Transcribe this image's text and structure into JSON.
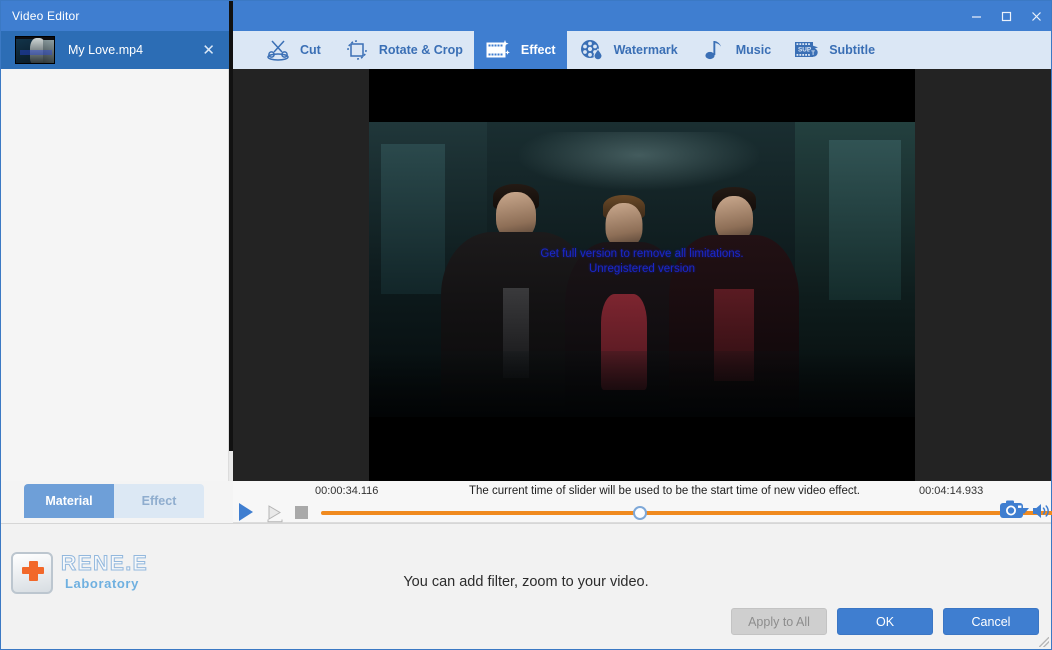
{
  "window": {
    "title": "Video Editor",
    "minimize_label": "—",
    "maximize_label": "☐",
    "close_label": "✕",
    "accent_color": "#3f7ed0"
  },
  "file_tab": {
    "name": "My Love.mp4",
    "close_label": "✕",
    "thumbnail_name": "video-thumbnail"
  },
  "toolbar": {
    "tabs": [
      {
        "label": "Cut",
        "icon": "scissors-icon",
        "active": false
      },
      {
        "label": "Rotate & Crop",
        "icon": "rotate-crop-icon",
        "active": false
      },
      {
        "label": "Effect",
        "icon": "film-sparkle-icon",
        "active": true
      },
      {
        "label": "Watermark",
        "icon": "watermark-icon",
        "active": false
      },
      {
        "label": "Music",
        "icon": "music-note-icon",
        "active": false
      },
      {
        "label": "Subtitle",
        "icon": "subtitle-icon",
        "active": false
      }
    ]
  },
  "preview": {
    "watermark_line1": "Get full version to remove all limitations.",
    "watermark_line2": "Unregistered version"
  },
  "effect_popup": {
    "chevron": "⌄",
    "buttons": [
      {
        "name": "add-filter-button",
        "icon": "magic-wand-plus-icon",
        "selected": true
      },
      {
        "name": "add-zoom-button",
        "icon": "magnifier-plus-icon",
        "selected": false
      },
      {
        "name": "add-volume-button",
        "icon": "speaker-plus-icon",
        "selected": false
      }
    ],
    "selection_color": "#e02020"
  },
  "transport": {
    "current_time": "00:00:34.116",
    "total_time": "00:04:14.933",
    "hint": "The current time of slider will be used to be the start time of new video effect.",
    "play_label": "play-button",
    "frame_label": "next-frame-button",
    "stop_label": "stop-button",
    "slider_position_percent": 37,
    "track_color": "#f08a1e",
    "snapshot_label": "snapshot-button",
    "volume_label": "volume-button"
  },
  "panel_tabs": [
    {
      "label": "Material",
      "active": true
    },
    {
      "label": "Effect",
      "active": false
    }
  ],
  "branding": {
    "name": "RENE.E",
    "tagline": "Laboratory"
  },
  "footer": {
    "hint": "You can add filter, zoom to your video.",
    "apply_to_all": "Apply to All",
    "ok": "OK",
    "cancel": "Cancel"
  }
}
